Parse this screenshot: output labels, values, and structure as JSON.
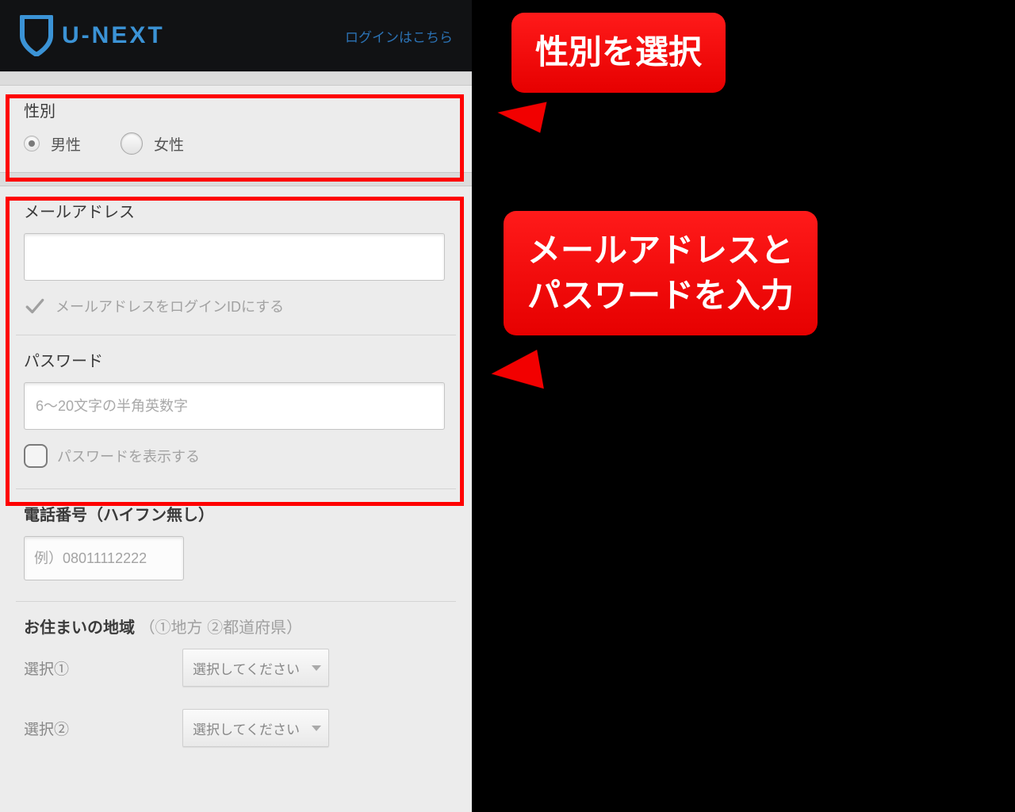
{
  "header": {
    "brand_text": "U-NEXT",
    "login_link": "ログインはこちら"
  },
  "gender": {
    "label": "性別",
    "male": "男性",
    "female": "女性"
  },
  "email": {
    "label": "メールアドレス",
    "use_as_login_id": "メールアドレスをログインIDにする"
  },
  "password": {
    "label": "パスワード",
    "placeholder": "6〜20文字の半角英数字",
    "show_password": "パスワードを表示する"
  },
  "phone": {
    "label": "電話番号（ハイフン無し）",
    "placeholder": "例）08011112222"
  },
  "region": {
    "label_main": "お住まいの地域",
    "label_hint": "（①地方 ②都道府県）",
    "select1_label": "選択①",
    "select2_label": "選択②",
    "select_placeholder": "選択してください"
  },
  "callouts": {
    "bubble1": "性別を選択",
    "bubble2_line1": "メールアドレスと",
    "bubble2_line2": "パスワードを入力"
  }
}
